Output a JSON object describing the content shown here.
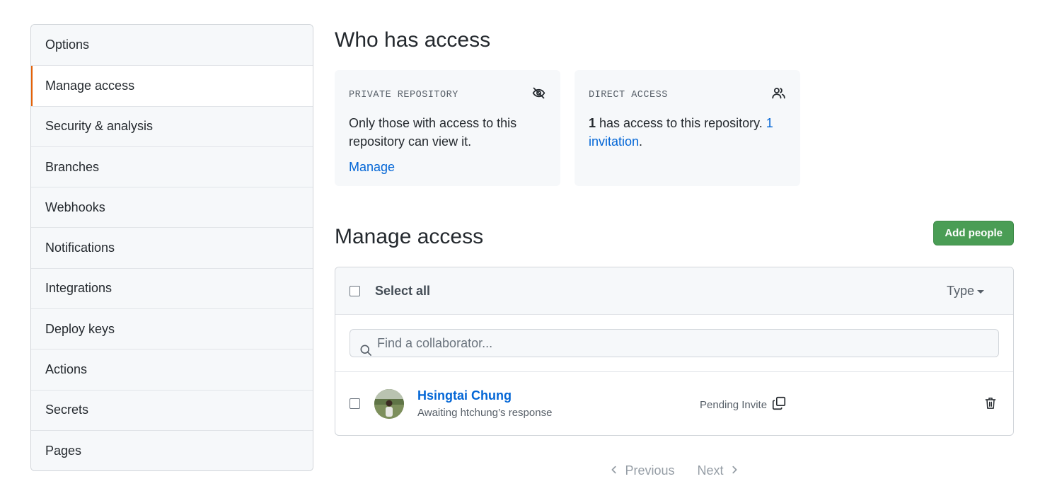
{
  "sidebar": {
    "items": [
      {
        "label": "Options"
      },
      {
        "label": "Manage access"
      },
      {
        "label": "Security & analysis"
      },
      {
        "label": "Branches"
      },
      {
        "label": "Webhooks"
      },
      {
        "label": "Notifications"
      },
      {
        "label": "Integrations"
      },
      {
        "label": "Deploy keys"
      },
      {
        "label": "Actions"
      },
      {
        "label": "Secrets"
      },
      {
        "label": "Pages"
      }
    ],
    "selected": "Manage access",
    "accent_color": "#e36209"
  },
  "who_has_access": {
    "title": "Who has access",
    "private_card": {
      "heading": "PRIVATE REPOSITORY",
      "icon": "eye-closed-icon",
      "text": "Only those with access to this repository can view it.",
      "link": "Manage"
    },
    "direct_card": {
      "heading": "DIRECT ACCESS",
      "icon": "people-icon",
      "count": "1",
      "text": " has access to this repository. ",
      "invitation_link": "1 invitation",
      "suffix": "."
    }
  },
  "manage_access": {
    "title": "Manage access",
    "add_button": "Add people",
    "add_button_color": "#4a9d55",
    "select_all": "Select all",
    "type_filter": "Type",
    "search_placeholder": "Find a collaborator...",
    "members": [
      {
        "name": "Hsingtai Chung",
        "status_text": "Awaiting htchung’s response",
        "badge": "Pending Invite",
        "copy_icon": "copy-icon",
        "delete_icon": "trash-icon"
      }
    ]
  },
  "pagination": {
    "previous": "Previous",
    "next": "Next"
  }
}
